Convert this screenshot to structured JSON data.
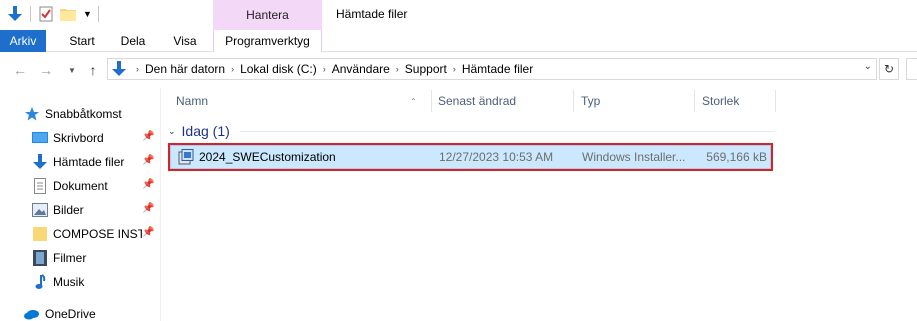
{
  "window": {
    "title": "Hämtade filer",
    "context_header": "Hantera"
  },
  "ribbon": {
    "tabs": [
      {
        "label": "Arkiv"
      },
      {
        "label": "Start"
      },
      {
        "label": "Dela"
      },
      {
        "label": "Visa"
      },
      {
        "label": "Programverktyg"
      }
    ]
  },
  "address": {
    "crumbs": [
      "Den här datorn",
      "Lokal disk (C:)",
      "Användare",
      "Support",
      "Hämtade filer"
    ]
  },
  "sidebar": {
    "items": [
      {
        "label": "Snabbåtkomst",
        "icon": "star-icon",
        "pinned": false
      },
      {
        "label": "Skrivbord",
        "icon": "desktop-icon",
        "pinned": true
      },
      {
        "label": "Hämtade filer",
        "icon": "download-icon",
        "pinned": true
      },
      {
        "label": "Dokument",
        "icon": "document-icon",
        "pinned": true
      },
      {
        "label": "Bilder",
        "icon": "pictures-icon",
        "pinned": true
      },
      {
        "label": "COMPOSE INSTA",
        "icon": "folder-icon",
        "pinned": true
      },
      {
        "label": "Filmer",
        "icon": "film-icon",
        "pinned": false
      },
      {
        "label": "Musik",
        "icon": "music-icon",
        "pinned": false
      },
      {
        "label": "OneDrive",
        "icon": "cloud-icon",
        "pinned": false
      }
    ]
  },
  "columns": {
    "name": "Namn",
    "date": "Senast ändrad",
    "type": "Typ",
    "size": "Storlek"
  },
  "group": {
    "label": "Idag (1)"
  },
  "files": [
    {
      "name": "2024_SWECustomization",
      "date": "12/27/2023 10:53 AM",
      "type": "Windows Installer...",
      "size": "569,166 kB"
    }
  ],
  "colors": {
    "accent": "#1e6fcc",
    "context_tab": "#f4d8f8",
    "selection": "#cce8ff",
    "highlight_border": "#e02020",
    "group_text": "#1e3287"
  }
}
